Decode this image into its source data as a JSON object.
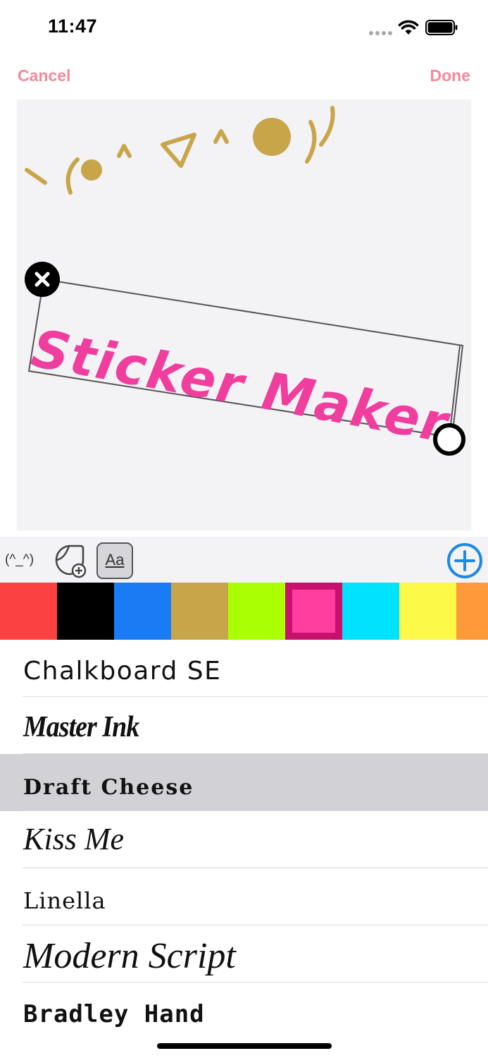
{
  "status_bar": {
    "time": "11:47",
    "icons": [
      "signal-dots-icon",
      "wifi-icon",
      "battery-icon"
    ]
  },
  "nav": {
    "cancel_label": "Cancel",
    "done_label": "Done",
    "accent_color": "#f5899b"
  },
  "canvas": {
    "background": "#f3f3f6",
    "stickers": [
      {
        "type": "kaomoji",
        "text": "\\(●＾▽＾●)/",
        "color": "#c9a54a"
      },
      {
        "type": "text",
        "text": "Sticker Maker",
        "color": "#f03e9e",
        "selected": true
      }
    ]
  },
  "toolbar": {
    "kaomoji_label": "(^_^)",
    "text_tool_label": "Aa",
    "icons": [
      "add-sticker-icon",
      "text-tool-icon",
      "add-circle-icon"
    ],
    "add_color": "#1e88e5"
  },
  "palette": {
    "colors": [
      "#fb4141",
      "#000000",
      "#1a7cf5",
      "#c9a54a",
      "#aaff00",
      "#ff3ea0",
      "#00e2ff",
      "#fdf948",
      "#ff9a3a"
    ],
    "selected_index": 5
  },
  "font_list": {
    "selected_index": 2,
    "fonts": [
      {
        "name": "Chalkboard SE"
      },
      {
        "name": "Master Ink"
      },
      {
        "name": "Draft Cheese"
      },
      {
        "name": "Kiss Me"
      },
      {
        "name": "Linella"
      },
      {
        "name": "Modern Script"
      },
      {
        "name": "Bradley Hand"
      }
    ]
  }
}
